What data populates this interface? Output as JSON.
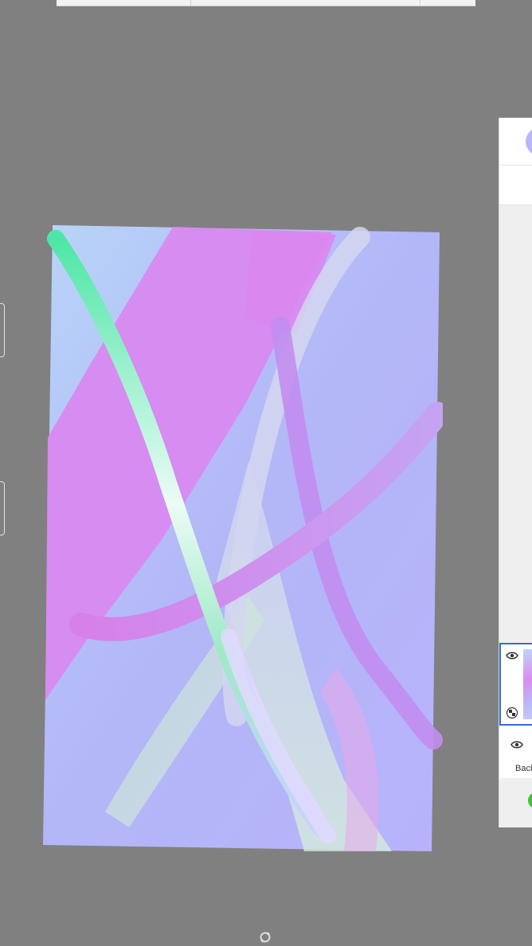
{
  "layers_panel": {
    "layers": [
      {
        "label": "",
        "active": true
      },
      {
        "label": "Back",
        "active": false
      }
    ]
  },
  "colors": {
    "workspace_bg": "#808080",
    "selection_border": "#2f6fd0",
    "avatar": "#b9b7f5",
    "status_dot": "#3cc43c"
  },
  "icons": {
    "visibility": "eye-icon",
    "transparency": "checker-icon",
    "reset": "rotate-icon"
  }
}
